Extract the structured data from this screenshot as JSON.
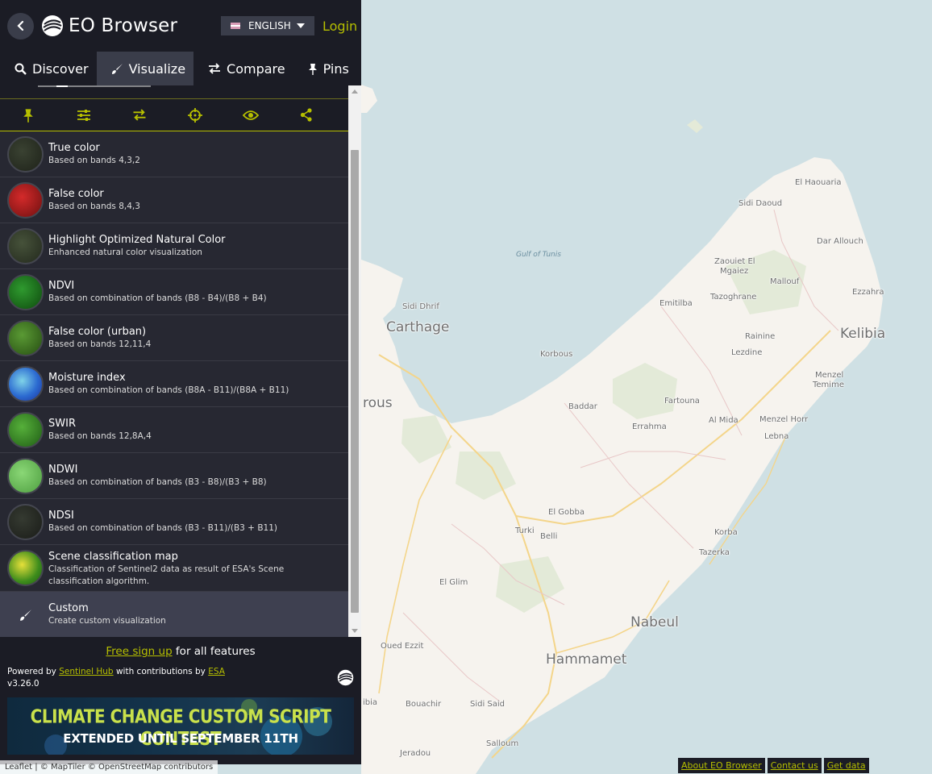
{
  "app": {
    "logo_text": "EO Browser",
    "language": "ENGLISH",
    "login": "Login"
  },
  "tabs": [
    {
      "label": "Discover",
      "icon": "search-icon"
    },
    {
      "label": "Visualize",
      "icon": "paintbrush-icon"
    },
    {
      "label": "Compare",
      "icon": "swap-arrows-icon"
    },
    {
      "label": "Pins",
      "icon": "pin-icon"
    }
  ],
  "toolbar_icons": [
    "pin-icon",
    "sliders-icon",
    "swap-arrows-icon",
    "crosshair-icon",
    "eye-icon",
    "share-icon"
  ],
  "layers": [
    {
      "title": "True color",
      "desc": "Based on bands 4,3,2",
      "thumb_color": "#2b3426"
    },
    {
      "title": "False color",
      "desc": "Based on bands 8,4,3",
      "thumb_color": "#b01d1d"
    },
    {
      "title": "Highlight Optimized Natural Color",
      "desc": "Enhanced natural color visualization",
      "thumb_color": "#2f3a28"
    },
    {
      "title": "NDVI",
      "desc": "Based on combination of bands (B8 - B4)/(B8 + B4)",
      "thumb_color": "#1f7a1f"
    },
    {
      "title": "False color (urban)",
      "desc": "Based on bands 12,11,4",
      "thumb_color": "#3e7d22"
    },
    {
      "title": "Moisture index",
      "desc": "Based on combination of bands (B8A - B11)/(B8A + B11)",
      "thumb_color": "#2c6bd1"
    },
    {
      "title": "SWIR",
      "desc": "Based on bands 12,8A,4",
      "thumb_color": "#3a8a25"
    },
    {
      "title": "NDWI",
      "desc": "Based on combination of bands (B3 - B8)/(B3 + B8)",
      "thumb_color": "#6fbf5a"
    },
    {
      "title": "NDSI",
      "desc": "Based on combination of bands (B3 - B11)/(B3 + B11)",
      "thumb_color": "#272a25"
    },
    {
      "title": "Scene classification map",
      "desc": "Classification of Sentinel2 data as result of ESA's Scene classification algorithm.",
      "thumb_color": "#3d8c1c"
    }
  ],
  "custom_layer": {
    "title": "Custom",
    "desc": "Create custom visualization",
    "icon": "paintbrush-icon"
  },
  "footer": {
    "signup_link": "Free sign up",
    "signup_rest": " for all features",
    "powered_by": "Powered by ",
    "sentinel_hub": "Sentinel Hub",
    "contributions": " with contributions by ",
    "esa": "ESA",
    "version": "v3.26.0",
    "banner_line1": "CLIMATE CHANGE CUSTOM SCRIPT CONTEST",
    "banner_line2": "EXTENDED UNTIL SEPTEMBER 11TH"
  },
  "attribution": "Leaflet | © MapTiler © OpenStreetMap contributors",
  "bottom_links": [
    "About EO Browser",
    "Contact us",
    "Get data"
  ],
  "map_labels": [
    {
      "name": "Carthage",
      "size": "big"
    },
    {
      "name": "Kelibia",
      "size": "big"
    },
    {
      "name": "Nabeul",
      "size": "big"
    },
    {
      "name": "Hammamet",
      "size": "big"
    },
    {
      "name": "rous",
      "size": "big"
    },
    {
      "name": "Gulf of Tunis",
      "size": "sea"
    },
    {
      "name": "El Haouaria",
      "size": "small"
    },
    {
      "name": "Sidi Daoud",
      "size": "small"
    },
    {
      "name": "Dar Allouch",
      "size": "small"
    },
    {
      "name": "Zaouiet El",
      "size": "small"
    },
    {
      "name": "Mgaiez",
      "size": "small"
    },
    {
      "name": "Mallouf",
      "size": "small"
    },
    {
      "name": "Ezzahra",
      "size": "small"
    },
    {
      "name": "Sidi Dhrif",
      "size": "small"
    },
    {
      "name": "Emitilba",
      "size": "small"
    },
    {
      "name": "Tazoghrane",
      "size": "small"
    },
    {
      "name": "Rainine",
      "size": "small"
    },
    {
      "name": "Lezdine",
      "size": "small"
    },
    {
      "name": "Korbous",
      "size": "small"
    },
    {
      "name": "Menzel",
      "size": "small"
    },
    {
      "name": "Temime",
      "size": "small"
    },
    {
      "name": "Baddar",
      "size": "small"
    },
    {
      "name": "Fartouna",
      "size": "small"
    },
    {
      "name": "Al Mida",
      "size": "small"
    },
    {
      "name": "Menzel Horr",
      "size": "small"
    },
    {
      "name": "Errahma",
      "size": "small"
    },
    {
      "name": "Lebna",
      "size": "small"
    },
    {
      "name": "El Gobba",
      "size": "small"
    },
    {
      "name": "Turki",
      "size": "small"
    },
    {
      "name": "Belli",
      "size": "small"
    },
    {
      "name": "Korba",
      "size": "small"
    },
    {
      "name": "Tazerka",
      "size": "small"
    },
    {
      "name": "El Glim",
      "size": "small"
    },
    {
      "name": "Oued Ezzit",
      "size": "small"
    },
    {
      "name": "Bouachir",
      "size": "small"
    },
    {
      "name": "Sidi Said",
      "size": "small"
    },
    {
      "name": "Salloum",
      "size": "small"
    },
    {
      "name": "Jeradou",
      "size": "small"
    },
    {
      "name": "ibia",
      "size": "small"
    }
  ],
  "colors": {
    "accent": "#b6bf00",
    "panel_bg": "#1b1c25",
    "sea": "#cfe0e4",
    "land": "#f6f3ee"
  }
}
